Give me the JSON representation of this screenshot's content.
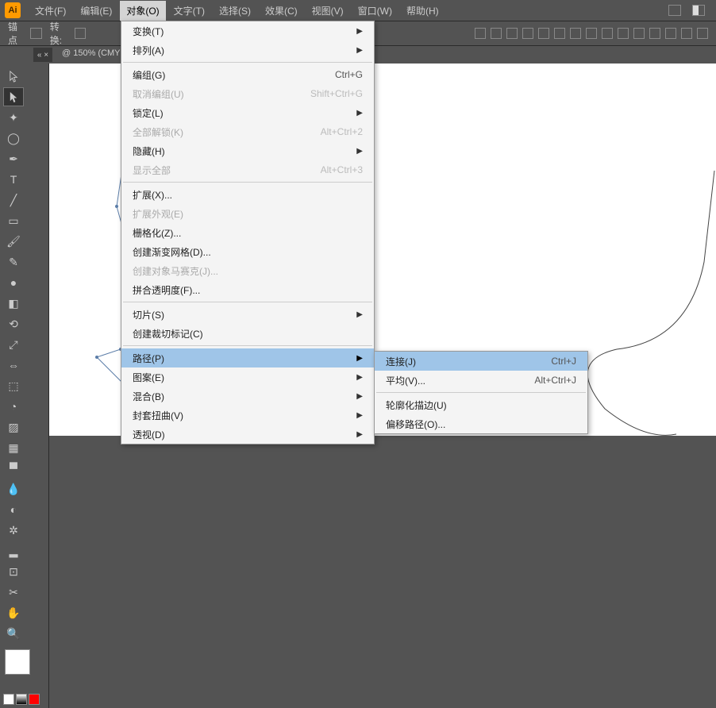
{
  "app": {
    "logo": "Ai"
  },
  "menu": {
    "items": [
      "文件(F)",
      "编辑(E)",
      "对象(O)",
      "文字(T)",
      "选择(S)",
      "效果(C)",
      "视图(V)",
      "窗口(W)",
      "帮助(H)"
    ],
    "active_index": 2
  },
  "toolbar": {
    "anchor": "锚点",
    "convert": "转换:"
  },
  "doc": {
    "tab": "@ 150% (CMY",
    "close": "« ×"
  },
  "dropdown": {
    "items": [
      {
        "label": "变换(T)",
        "arrow": true
      },
      {
        "label": "排列(A)",
        "arrow": true
      },
      {
        "sep": true
      },
      {
        "label": "编组(G)",
        "shortcut": "Ctrl+G"
      },
      {
        "label": "取消编组(U)",
        "shortcut": "Shift+Ctrl+G",
        "disabled": true
      },
      {
        "label": "锁定(L)",
        "arrow": true
      },
      {
        "label": "全部解锁(K)",
        "shortcut": "Alt+Ctrl+2",
        "disabled": true
      },
      {
        "label": "隐藏(H)",
        "arrow": true
      },
      {
        "label": "显示全部",
        "shortcut": "Alt+Ctrl+3",
        "disabled": true
      },
      {
        "sep": true
      },
      {
        "label": "扩展(X)..."
      },
      {
        "label": "扩展外观(E)",
        "disabled": true
      },
      {
        "label": "栅格化(Z)..."
      },
      {
        "label": "创建渐变网格(D)..."
      },
      {
        "label": "创建对象马赛克(J)...",
        "disabled": true
      },
      {
        "label": "拼合透明度(F)..."
      },
      {
        "sep": true
      },
      {
        "label": "切片(S)",
        "arrow": true
      },
      {
        "label": "创建裁切标记(C)"
      },
      {
        "sep": true
      },
      {
        "label": "路径(P)",
        "arrow": true,
        "hover": true
      },
      {
        "label": "图案(E)",
        "arrow": true
      },
      {
        "label": "混合(B)",
        "arrow": true
      },
      {
        "label": "封套扭曲(V)",
        "arrow": true
      },
      {
        "label": "透视(D)",
        "arrow": true
      }
    ]
  },
  "submenu": {
    "items": [
      {
        "label": "连接(J)",
        "shortcut": "Ctrl+J",
        "hover": true
      },
      {
        "label": "平均(V)...",
        "shortcut": "Alt+Ctrl+J"
      },
      {
        "sep": true
      },
      {
        "label": "轮廓化描边(U)"
      },
      {
        "label": "偏移路径(O)..."
      }
    ]
  }
}
